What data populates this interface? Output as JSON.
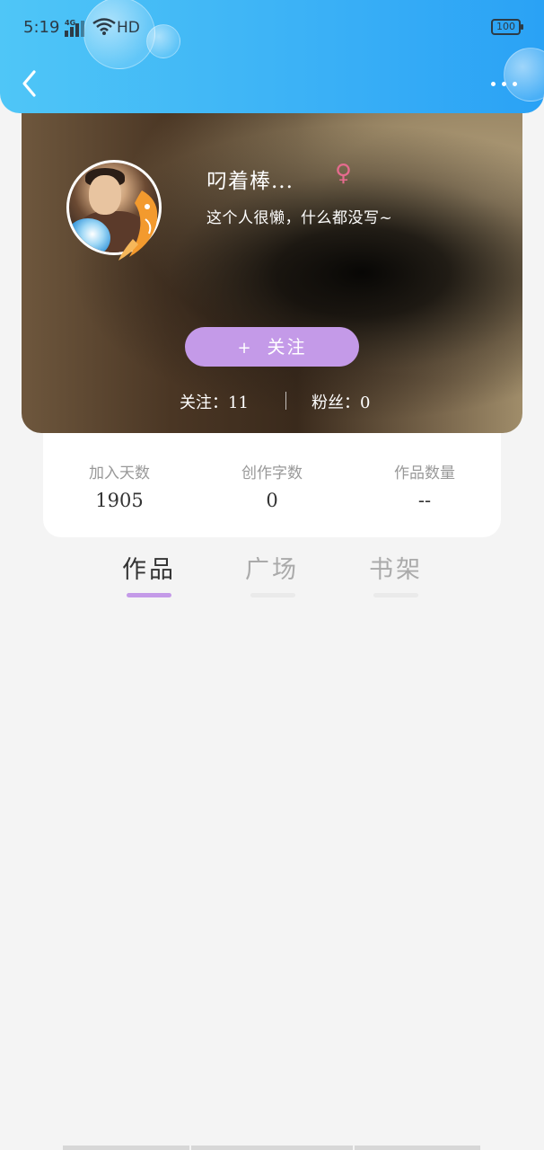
{
  "status_bar": {
    "time": "5:19",
    "network": "4G",
    "hd": "HD",
    "battery": "100"
  },
  "nav": {
    "back_icon": "chevron-left-icon",
    "more_icon": "more-dots-icon"
  },
  "profile": {
    "username": "叼着棒...",
    "gender_symbol": "♀",
    "bio": "这个人很懒，什么都没写~",
    "follow_plus": "+",
    "follow_label": "关注",
    "following_text": "关注：11",
    "fans_text": "粉丝：0"
  },
  "stats": [
    {
      "label": "加入天数",
      "value": "1905"
    },
    {
      "label": "创作字数",
      "value": "0"
    },
    {
      "label": "作品数量",
      "value": "--"
    }
  ],
  "tabs": [
    {
      "label": "作品",
      "active": true
    },
    {
      "label": "广场",
      "active": false
    },
    {
      "label": "书架",
      "active": false
    }
  ],
  "colors": {
    "header_gradient": "#3ab0f6",
    "accent": "#c49ae8",
    "gender": "#e56b8e",
    "background": "#f4f4f4"
  }
}
